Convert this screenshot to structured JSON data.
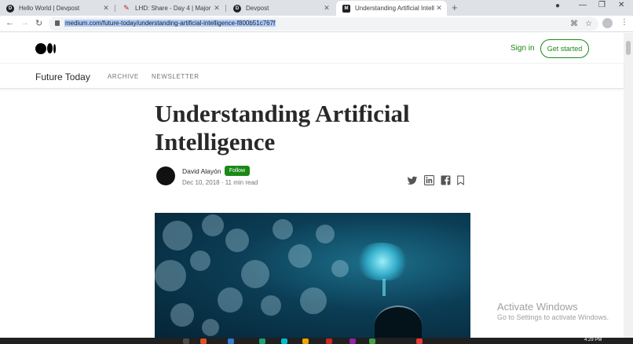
{
  "browser": {
    "tabs": [
      {
        "title": "Hello World | Devpost",
        "favicon": "devpost-icon",
        "active": false
      },
      {
        "title": "LHD: Share - Day 4 | Major Leag",
        "favicon": "pencil-icon",
        "active": false
      },
      {
        "title": "Devpost",
        "favicon": "devpost-icon",
        "active": false
      },
      {
        "title": "Understanding Artificial Intellig",
        "favicon": "medium-icon",
        "active": true
      }
    ],
    "new_tab_symbol": "+",
    "url": "medium.com/future-today/understanding-artificial-intelligence-f800b51c767f"
  },
  "medium": {
    "sign_in": "Sign in",
    "get_started": "Get started",
    "publication": {
      "name": "Future Today",
      "nav": [
        "ARCHIVE",
        "NEWSLETTER"
      ]
    },
    "article": {
      "title_line1": "Understanding Artificial",
      "title_line2": "Intelligence",
      "author": "David Alayón",
      "follow": "Follow",
      "meta": "Dec 10, 2018 · 11 min read",
      "share_icons": [
        "twitter-icon",
        "linkedin-icon",
        "facebook-icon",
        "bookmark-icon"
      ]
    }
  },
  "windows": {
    "activate_title": "Activate Windows",
    "activate_sub": "Go to Settings to activate Windows.",
    "clock": "4:29 PM"
  },
  "colors": {
    "brand_green": "#1a8917",
    "tab_strip": "#dee1e6",
    "url_highlight": "#aecbfa"
  }
}
